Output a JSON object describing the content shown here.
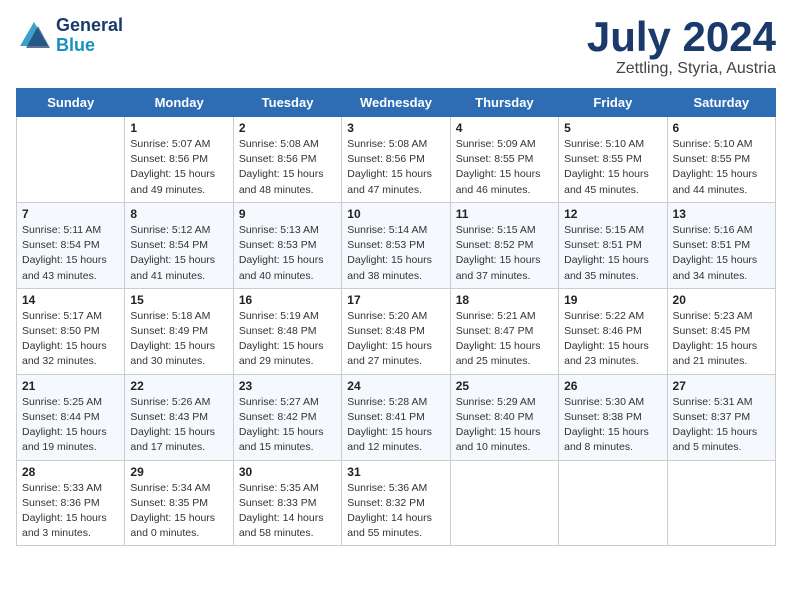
{
  "logo": {
    "line1": "General",
    "line2": "Blue"
  },
  "title": "July 2024",
  "subtitle": "Zettling, Styria, Austria",
  "header": {
    "days": [
      "Sunday",
      "Monday",
      "Tuesday",
      "Wednesday",
      "Thursday",
      "Friday",
      "Saturday"
    ]
  },
  "weeks": [
    [
      {
        "num": "",
        "info": ""
      },
      {
        "num": "1",
        "info": "Sunrise: 5:07 AM\nSunset: 8:56 PM\nDaylight: 15 hours\nand 49 minutes."
      },
      {
        "num": "2",
        "info": "Sunrise: 5:08 AM\nSunset: 8:56 PM\nDaylight: 15 hours\nand 48 minutes."
      },
      {
        "num": "3",
        "info": "Sunrise: 5:08 AM\nSunset: 8:56 PM\nDaylight: 15 hours\nand 47 minutes."
      },
      {
        "num": "4",
        "info": "Sunrise: 5:09 AM\nSunset: 8:55 PM\nDaylight: 15 hours\nand 46 minutes."
      },
      {
        "num": "5",
        "info": "Sunrise: 5:10 AM\nSunset: 8:55 PM\nDaylight: 15 hours\nand 45 minutes."
      },
      {
        "num": "6",
        "info": "Sunrise: 5:10 AM\nSunset: 8:55 PM\nDaylight: 15 hours\nand 44 minutes."
      }
    ],
    [
      {
        "num": "7",
        "info": "Sunrise: 5:11 AM\nSunset: 8:54 PM\nDaylight: 15 hours\nand 43 minutes."
      },
      {
        "num": "8",
        "info": "Sunrise: 5:12 AM\nSunset: 8:54 PM\nDaylight: 15 hours\nand 41 minutes."
      },
      {
        "num": "9",
        "info": "Sunrise: 5:13 AM\nSunset: 8:53 PM\nDaylight: 15 hours\nand 40 minutes."
      },
      {
        "num": "10",
        "info": "Sunrise: 5:14 AM\nSunset: 8:53 PM\nDaylight: 15 hours\nand 38 minutes."
      },
      {
        "num": "11",
        "info": "Sunrise: 5:15 AM\nSunset: 8:52 PM\nDaylight: 15 hours\nand 37 minutes."
      },
      {
        "num": "12",
        "info": "Sunrise: 5:15 AM\nSunset: 8:51 PM\nDaylight: 15 hours\nand 35 minutes."
      },
      {
        "num": "13",
        "info": "Sunrise: 5:16 AM\nSunset: 8:51 PM\nDaylight: 15 hours\nand 34 minutes."
      }
    ],
    [
      {
        "num": "14",
        "info": "Sunrise: 5:17 AM\nSunset: 8:50 PM\nDaylight: 15 hours\nand 32 minutes."
      },
      {
        "num": "15",
        "info": "Sunrise: 5:18 AM\nSunset: 8:49 PM\nDaylight: 15 hours\nand 30 minutes."
      },
      {
        "num": "16",
        "info": "Sunrise: 5:19 AM\nSunset: 8:48 PM\nDaylight: 15 hours\nand 29 minutes."
      },
      {
        "num": "17",
        "info": "Sunrise: 5:20 AM\nSunset: 8:48 PM\nDaylight: 15 hours\nand 27 minutes."
      },
      {
        "num": "18",
        "info": "Sunrise: 5:21 AM\nSunset: 8:47 PM\nDaylight: 15 hours\nand 25 minutes."
      },
      {
        "num": "19",
        "info": "Sunrise: 5:22 AM\nSunset: 8:46 PM\nDaylight: 15 hours\nand 23 minutes."
      },
      {
        "num": "20",
        "info": "Sunrise: 5:23 AM\nSunset: 8:45 PM\nDaylight: 15 hours\nand 21 minutes."
      }
    ],
    [
      {
        "num": "21",
        "info": "Sunrise: 5:25 AM\nSunset: 8:44 PM\nDaylight: 15 hours\nand 19 minutes."
      },
      {
        "num": "22",
        "info": "Sunrise: 5:26 AM\nSunset: 8:43 PM\nDaylight: 15 hours\nand 17 minutes."
      },
      {
        "num": "23",
        "info": "Sunrise: 5:27 AM\nSunset: 8:42 PM\nDaylight: 15 hours\nand 15 minutes."
      },
      {
        "num": "24",
        "info": "Sunrise: 5:28 AM\nSunset: 8:41 PM\nDaylight: 15 hours\nand 12 minutes."
      },
      {
        "num": "25",
        "info": "Sunrise: 5:29 AM\nSunset: 8:40 PM\nDaylight: 15 hours\nand 10 minutes."
      },
      {
        "num": "26",
        "info": "Sunrise: 5:30 AM\nSunset: 8:38 PM\nDaylight: 15 hours\nand 8 minutes."
      },
      {
        "num": "27",
        "info": "Sunrise: 5:31 AM\nSunset: 8:37 PM\nDaylight: 15 hours\nand 5 minutes."
      }
    ],
    [
      {
        "num": "28",
        "info": "Sunrise: 5:33 AM\nSunset: 8:36 PM\nDaylight: 15 hours\nand 3 minutes."
      },
      {
        "num": "29",
        "info": "Sunrise: 5:34 AM\nSunset: 8:35 PM\nDaylight: 15 hours\nand 0 minutes."
      },
      {
        "num": "30",
        "info": "Sunrise: 5:35 AM\nSunset: 8:33 PM\nDaylight: 14 hours\nand 58 minutes."
      },
      {
        "num": "31",
        "info": "Sunrise: 5:36 AM\nSunset: 8:32 PM\nDaylight: 14 hours\nand 55 minutes."
      },
      {
        "num": "",
        "info": ""
      },
      {
        "num": "",
        "info": ""
      },
      {
        "num": "",
        "info": ""
      }
    ]
  ]
}
